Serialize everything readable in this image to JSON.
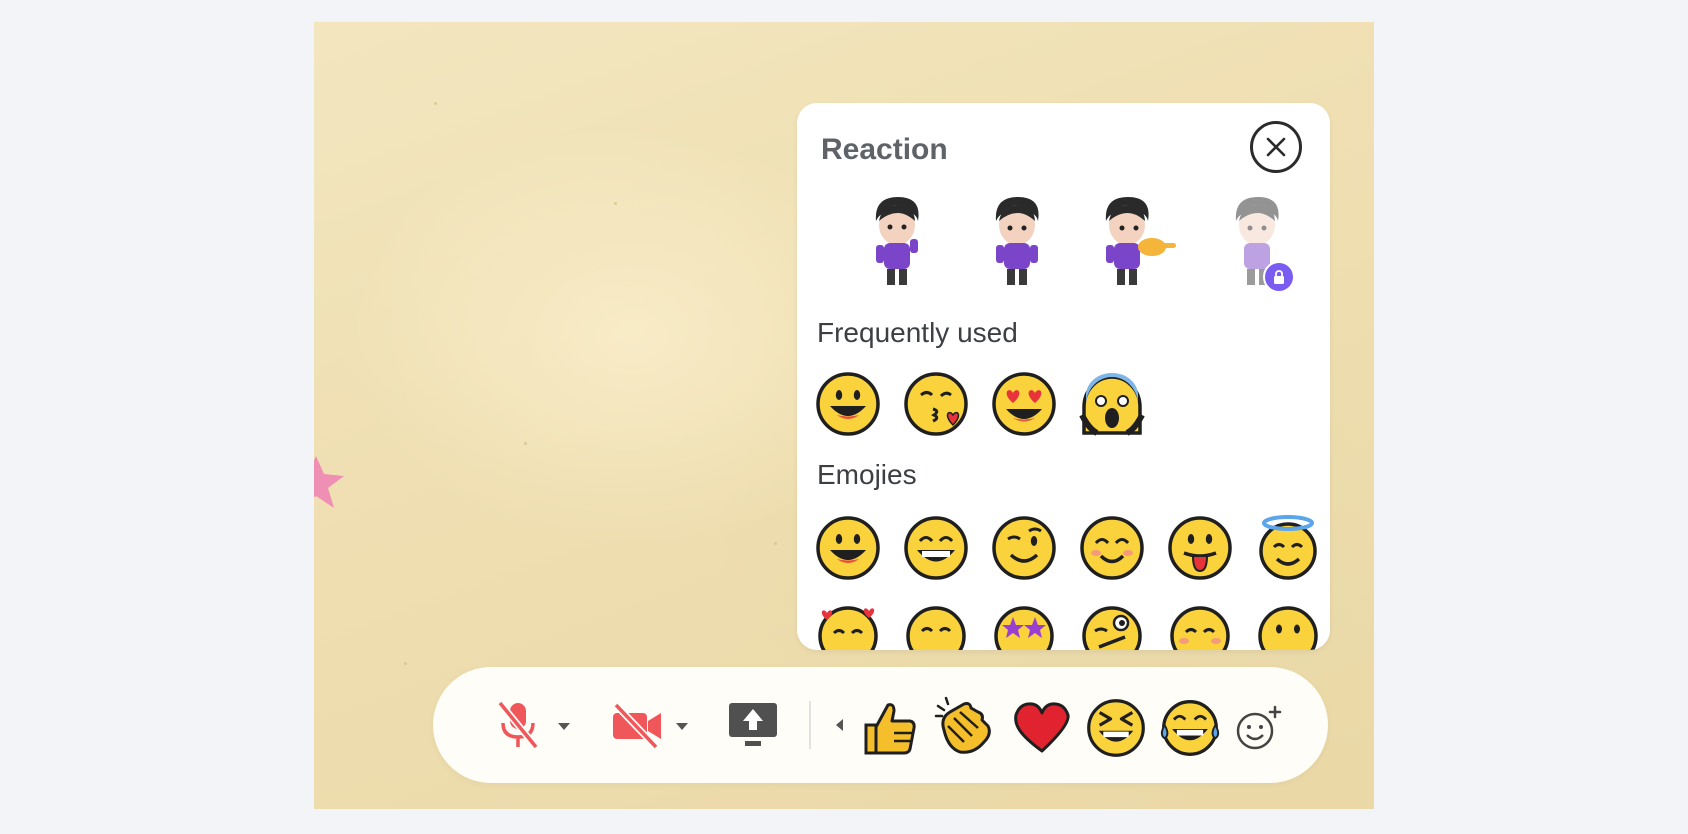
{
  "panel": {
    "title": "Reaction",
    "sections": {
      "frequent": "Frequently used",
      "emojis": "Emojies"
    },
    "avatars": [
      {
        "name": "avatar-reaction-cheer",
        "locked": false
      },
      {
        "name": "avatar-reaction-wave",
        "locked": false
      },
      {
        "name": "avatar-reaction-point",
        "locked": false
      },
      {
        "name": "avatar-reaction-locked",
        "locked": true
      }
    ],
    "frequent_emojis": [
      "grinning-face",
      "face-blowing-kiss",
      "smiling-face-with-heart-eyes",
      "face-screaming-in-fear"
    ],
    "emoji_grid": [
      "grinning-face",
      "grinning-face-with-smiling-eyes",
      "winking-face",
      "smiling-face-with-smiling-eyes",
      "face-with-tongue",
      "smiling-face-with-halo",
      "smiling-face-with-hearts",
      "kissing-face-with-smiling-eyes",
      "star-struck",
      "zany-face",
      "blushing-face",
      "kissing-face"
    ]
  },
  "toolbar": {
    "mic": "microphone-muted-icon",
    "camera": "camera-off-icon",
    "share": "screen-share-icon",
    "quick_reactions": [
      "thumbs-up",
      "clapping-hands",
      "red-heart",
      "grinning-squinting-face",
      "face-with-tears-of-joy"
    ],
    "more_reactions": "add-reaction-icon"
  },
  "colors": {
    "accent_purple": "#7b5cf0",
    "muted_red": "#f0575b",
    "emoji_yellow": "#f9d23c",
    "outline": "#1f1f1f"
  }
}
